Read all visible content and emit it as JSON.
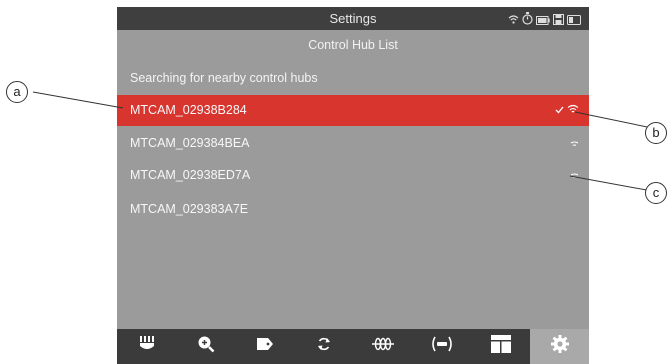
{
  "status_bar": {
    "title": "Settings",
    "icons": [
      "wifi-icon",
      "stopwatch-icon",
      "battery-icon",
      "save-icon",
      "card-icon"
    ]
  },
  "header": {
    "title": "Control Hub List"
  },
  "search_status": "Searching for nearby control hubs",
  "hubs": [
    {
      "name": "MTCAM_02938B284",
      "selected": true,
      "connected": true,
      "signal": "strong"
    },
    {
      "name": "MTCAM_029384BEA",
      "selected": false,
      "connected": false,
      "signal": "weak"
    },
    {
      "name": "MTCAM_02938ED7A",
      "selected": false,
      "connected": false,
      "signal": "weak"
    },
    {
      "name": "MTCAM_029383A7E",
      "selected": false,
      "connected": false,
      "signal": "none"
    }
  ],
  "nav": [
    {
      "icon": "brush-icon",
      "active": false
    },
    {
      "icon": "zoom-in-icon",
      "active": false
    },
    {
      "icon": "tag-icon",
      "active": false
    },
    {
      "icon": "rotate-icon",
      "active": false
    },
    {
      "icon": "coil-icon",
      "active": false
    },
    {
      "icon": "vibration-icon",
      "active": false
    },
    {
      "icon": "layout-icon",
      "active": false
    },
    {
      "icon": "gear-icon",
      "active": true
    }
  ],
  "callouts": [
    "a",
    "b",
    "c"
  ],
  "colors": {
    "screen_bg": "#9b9b9b",
    "status_bar_bg": "#3f3f3f",
    "selected_row": "#d8352e",
    "nav_bg": "#3b3b3b",
    "nav_active": "#a9a9a9"
  }
}
